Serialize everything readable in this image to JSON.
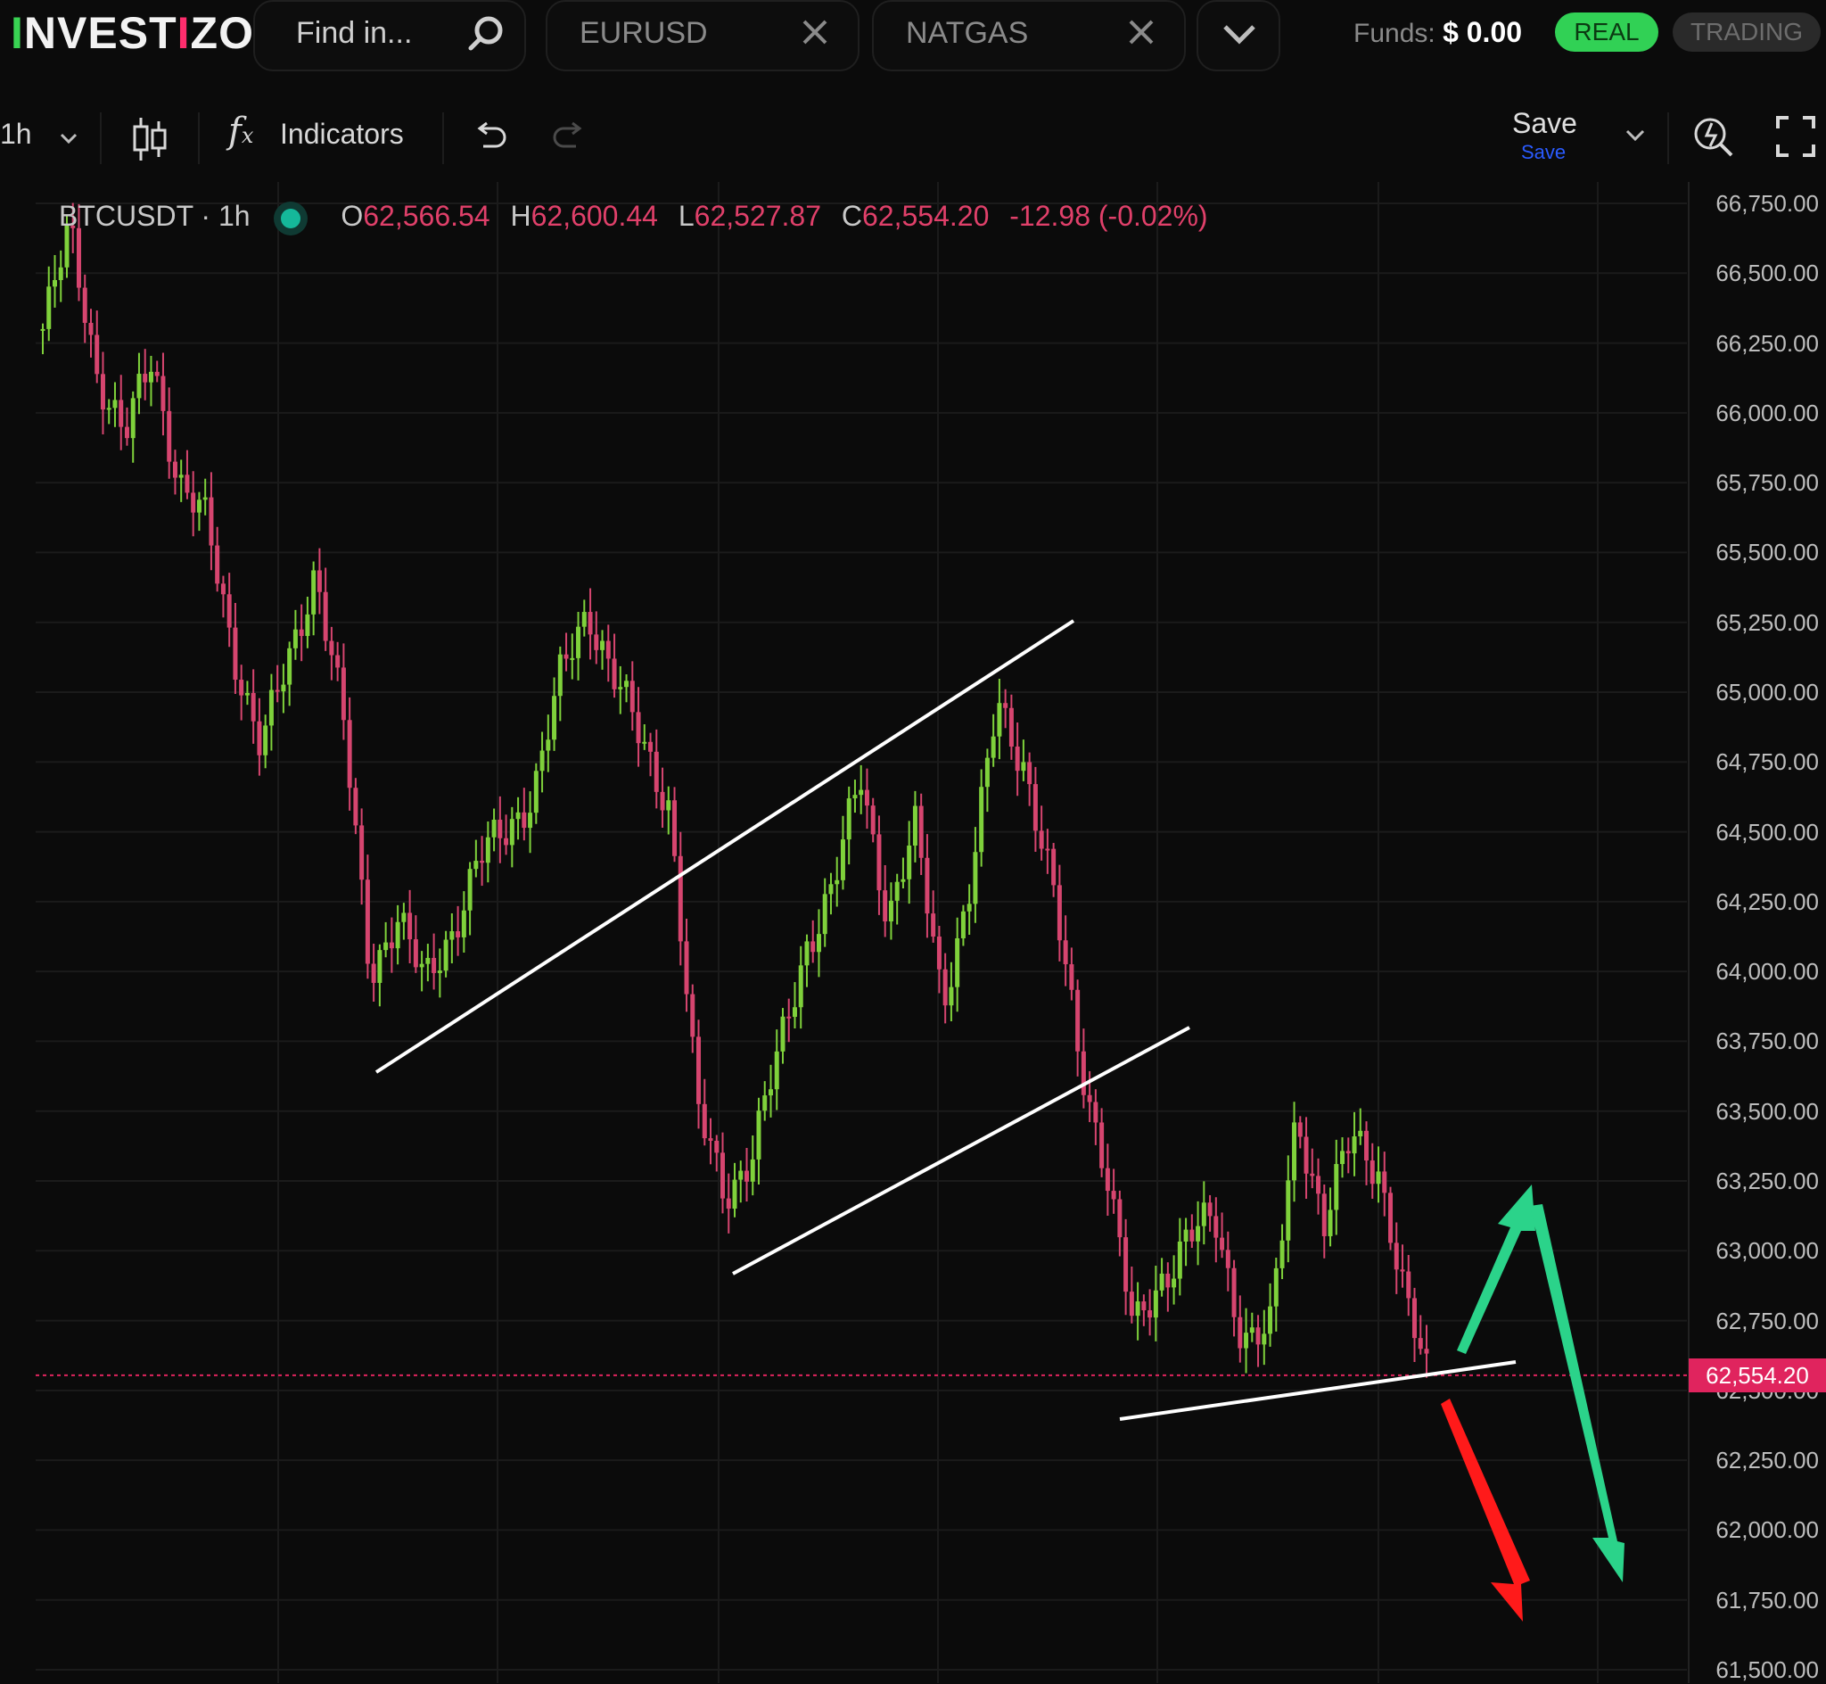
{
  "header": {
    "logo": "INVESTIZO",
    "search_placeholder": "Find in...",
    "tabs": [
      {
        "label": "EURUSD"
      },
      {
        "label": "NATGAS"
      }
    ],
    "funds_label": "Funds:",
    "funds_value": "$ 0.00",
    "real_label": "REAL",
    "trading_label": "TRADING"
  },
  "toolbar": {
    "interval": "1h",
    "indicators_label": "Indicators",
    "save_label": "Save",
    "save_sub": "Save"
  },
  "legend": {
    "symbol": "BTCUSDT · 1h",
    "open_key": "O",
    "open": "62,566.54",
    "high_key": "H",
    "high": "62,600.44",
    "low_key": "L",
    "low": "62,527.87",
    "close_key": "C",
    "close": "62,554.20",
    "change": "-12.98 (-0.02%)"
  },
  "colors": {
    "bull": "#7fd13b",
    "bear": "#d6456f",
    "accent": "#31d155",
    "last_price": "#e0245e",
    "arrow_up": "#2bd38a",
    "arrow_down": "#ff1a1a"
  },
  "chart_data": {
    "type": "line",
    "symbol": "BTCUSDT",
    "interval": "1h",
    "ylim": [
      61500,
      66800
    ],
    "y_ticks": [
      "66,750.00",
      "66,500.00",
      "66,250.00",
      "66,000.00",
      "65,750.00",
      "65,500.00",
      "65,250.00",
      "65,000.00",
      "64,750.00",
      "64,500.00",
      "64,250.00",
      "64,000.00",
      "63,750.00",
      "63,500.00",
      "63,250.00",
      "63,000.00",
      "62,750.00",
      "62,500.00",
      "62,250.00",
      "62,000.00",
      "61,750.00",
      "61,500.00"
    ],
    "last_price_label": "62,554.20",
    "last_price": 62554.2,
    "grid": true,
    "price_path": [
      {
        "i": 0,
        "p": 66300
      },
      {
        "i": 4,
        "p": 66650
      },
      {
        "i": 8,
        "p": 66150
      },
      {
        "i": 12,
        "p": 65900
      },
      {
        "i": 16,
        "p": 66200
      },
      {
        "i": 20,
        "p": 65750
      },
      {
        "i": 24,
        "p": 65600
      },
      {
        "i": 28,
        "p": 65150
      },
      {
        "i": 32,
        "p": 64800
      },
      {
        "i": 36,
        "p": 65100
      },
      {
        "i": 40,
        "p": 65450
      },
      {
        "i": 44,
        "p": 64900
      },
      {
        "i": 48,
        "p": 64000
      },
      {
        "i": 52,
        "p": 64200
      },
      {
        "i": 56,
        "p": 63950
      },
      {
        "i": 60,
        "p": 64150
      },
      {
        "i": 64,
        "p": 64400
      },
      {
        "i": 68,
        "p": 64500
      },
      {
        "i": 72,
        "p": 64650
      },
      {
        "i": 76,
        "p": 65050
      },
      {
        "i": 80,
        "p": 65300
      },
      {
        "i": 84,
        "p": 65050
      },
      {
        "i": 88,
        "p": 64800
      },
      {
        "i": 92,
        "p": 64600
      },
      {
        "i": 96,
        "p": 63500
      },
      {
        "i": 100,
        "p": 63200
      },
      {
        "i": 104,
        "p": 63350
      },
      {
        "i": 108,
        "p": 63700
      },
      {
        "i": 112,
        "p": 64100
      },
      {
        "i": 116,
        "p": 64300
      },
      {
        "i": 120,
        "p": 64700
      },
      {
        "i": 124,
        "p": 64200
      },
      {
        "i": 128,
        "p": 64500
      },
      {
        "i": 132,
        "p": 63900
      },
      {
        "i": 136,
        "p": 64300
      },
      {
        "i": 140,
        "p": 64950
      },
      {
        "i": 144,
        "p": 64750
      },
      {
        "i": 148,
        "p": 64300
      },
      {
        "i": 152,
        "p": 63700
      },
      {
        "i": 156,
        "p": 63300
      },
      {
        "i": 160,
        "p": 62700
      },
      {
        "i": 164,
        "p": 62900
      },
      {
        "i": 168,
        "p": 63050
      },
      {
        "i": 172,
        "p": 63100
      },
      {
        "i": 176,
        "p": 62700
      },
      {
        "i": 180,
        "p": 62700
      },
      {
        "i": 184,
        "p": 63500
      },
      {
        "i": 188,
        "p": 63100
      },
      {
        "i": 192,
        "p": 63400
      },
      {
        "i": 196,
        "p": 63300
      },
      {
        "i": 200,
        "p": 62800
      },
      {
        "i": 203,
        "p": 62554
      }
    ]
  }
}
